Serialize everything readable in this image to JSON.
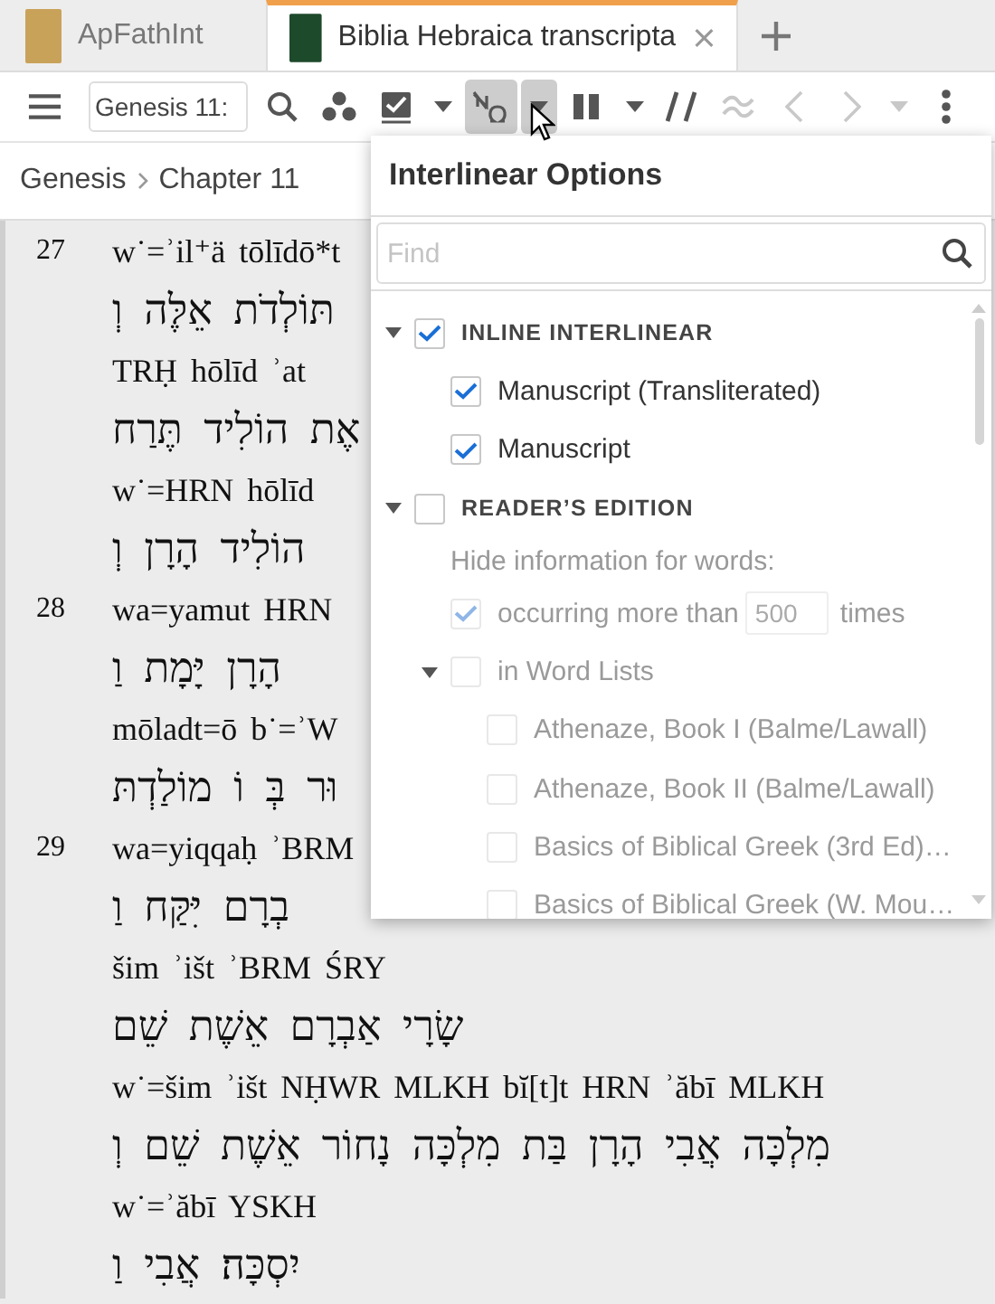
{
  "tabs": [
    {
      "label": "ApFathInt",
      "selected": false,
      "color": "#c9a25a"
    },
    {
      "label": "Biblia Hebraica transcripta",
      "selected": true,
      "color": "#1e4a2c"
    }
  ],
  "toolbar": {
    "location": "Genesis 11:",
    "tools": [
      {
        "kind": "search",
        "pressed": false,
        "disabled": false
      },
      {
        "kind": "visual-filter",
        "pressed": false,
        "disabled": false
      },
      {
        "kind": "highlight",
        "pressed": false,
        "disabled": false
      },
      {
        "kind": "caret",
        "pressed": false,
        "disabled": false
      },
      {
        "kind": "interlinear",
        "pressed": true,
        "disabled": false
      },
      {
        "kind": "caret",
        "pressed": true,
        "disabled": false
      },
      {
        "kind": "columns",
        "pressed": false,
        "disabled": false
      },
      {
        "kind": "caret",
        "pressed": false,
        "disabled": false
      },
      {
        "kind": "parallel",
        "pressed": false,
        "disabled": false
      },
      {
        "kind": "variants",
        "pressed": false,
        "disabled": true
      },
      {
        "kind": "back",
        "pressed": false,
        "disabled": true
      },
      {
        "kind": "forward",
        "pressed": false,
        "disabled": true
      },
      {
        "kind": "caret",
        "pressed": false,
        "disabled": true
      },
      {
        "kind": "more",
        "pressed": false,
        "disabled": false
      }
    ]
  },
  "breadcrumb": [
    "Genesis",
    "Chapter 11"
  ],
  "verses": [
    {
      "number": "27",
      "lines": [
        {
          "kind": "translit",
          "text": "w˙=ʾil⁺ä tōlīdō*t"
        },
        {
          "kind": "hebrew",
          "text": "תּוֹלְדֹת אֵלֶּה וְ"
        },
        {
          "kind": "translit",
          "text": "TRḤ hōlīd ʾat"
        },
        {
          "kind": "hebrew",
          "text": "אֶת הוֹלִיד תֶּרַח"
        },
        {
          "kind": "translit",
          "text": "w˙=HRN hōlīd"
        },
        {
          "kind": "hebrew",
          "text": "הוֹלִיד הָרָן וְ"
        }
      ]
    },
    {
      "number": "28",
      "lines": [
        {
          "kind": "translit",
          "text": "wa=yamut HRN"
        },
        {
          "kind": "hebrew",
          "text": "הָרָן יָּמָת וַ"
        },
        {
          "kind": "translit",
          "text": "mōladt=ō b˙=ʾW"
        },
        {
          "kind": "hebrew",
          "text": "וּר בְּ וֹ מוֹלַדְתּ"
        }
      ]
    },
    {
      "number": "29",
      "lines": [
        {
          "kind": "translit",
          "text": "wa=yiqqaḥ ʾBRM"
        },
        {
          "kind": "hebrew",
          "text": "בְרָם יִּקַּח וַ"
        },
        {
          "kind": "translit",
          "text": "šim ʾišt ʾBRM ŚRY"
        },
        {
          "kind": "hebrew",
          "text": "שָׂרָי אַבְרָם אֵשֶׁת שֵׁם"
        },
        {
          "kind": "translit",
          "text": "w˙=šim ʾišt NḤWR MLKH bĭ[t]t HRN ʾăbī MLKH"
        },
        {
          "kind": "hebrew",
          "text": "מִלְכָּה אֲבִי הָרָן בַּת מִלְכָּה נָחוֹר אֵשֶׁת שֵׁם וְ"
        },
        {
          "kind": "translit",
          "text": "w˙=ʾăbī YSKH"
        },
        {
          "kind": "hebrew",
          "text": "יִסְכָּה׃ אֲבִי וַ"
        }
      ]
    }
  ],
  "popup": {
    "title": "Interlinear Options",
    "search": {
      "placeholder": "Find"
    },
    "tree": [
      {
        "kind": "group",
        "label": "INLINE INTERLINEAR",
        "checked": true,
        "expanded": true,
        "disabled": false,
        "children": [
          {
            "kind": "option",
            "label": "Manuscript (Transliterated)",
            "checked": true,
            "disabled": false
          },
          {
            "kind": "option",
            "label": "Manuscript",
            "checked": true,
            "disabled": false
          }
        ]
      },
      {
        "kind": "group",
        "label": "READER’S EDITION",
        "checked": false,
        "expanded": true,
        "disabled": false,
        "children": [
          {
            "kind": "note",
            "text": "Hide information for words:"
          },
          {
            "kind": "threshold",
            "before": "occurring more than",
            "value": "500",
            "after": "times",
            "checked": true,
            "disabled": true
          },
          {
            "kind": "list",
            "label": "in Word Lists",
            "checked": false,
            "expanded": true,
            "disabled": true,
            "children": [
              {
                "kind": "option",
                "label": "Athenaze, Book I (Balme/Lawall)",
                "checked": false,
                "disabled": true
              },
              {
                "kind": "option",
                "label": "Athenaze, Book II (Balme/Lawall)",
                "checked": false,
                "disabled": true
              },
              {
                "kind": "option",
                "label": "Basics of Biblical Greek (3rd Ed)…",
                "checked": false,
                "disabled": true
              },
              {
                "kind": "option",
                "label": "Basics of Biblical Greek (W. Mou…",
                "checked": false,
                "disabled": true
              }
            ]
          }
        ]
      }
    ]
  }
}
